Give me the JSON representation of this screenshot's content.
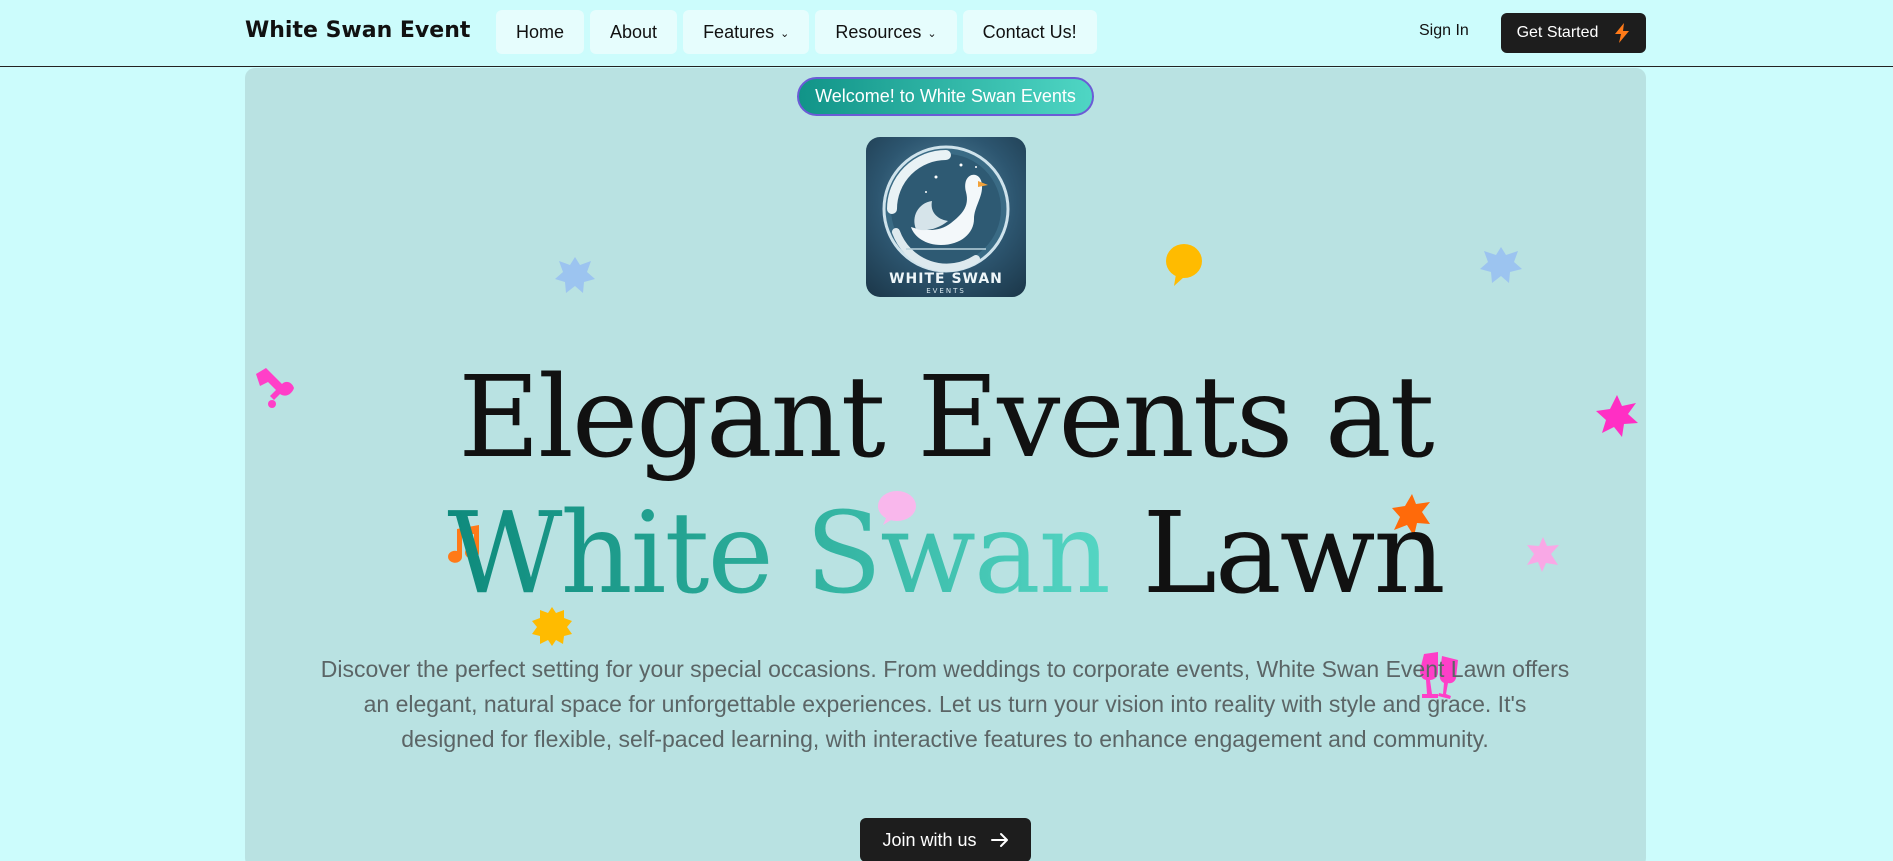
{
  "header": {
    "brand": "White Swan Event",
    "nav": [
      {
        "label": "Home"
      },
      {
        "label": "About"
      },
      {
        "label": "Features",
        "dropdown": true
      },
      {
        "label": "Resources",
        "dropdown": true
      },
      {
        "label": "Contact Us!"
      }
    ],
    "sign_in": "Sign In",
    "get_started": "Get Started"
  },
  "hero": {
    "badge": "Welcome! to White Swan Events",
    "logo": {
      "title": "WHITE SWAN",
      "subtitle": "EVENTS"
    },
    "headline_line1": "Elegant Events at",
    "headline_highlight": "White Swan",
    "headline_end": "Lawn",
    "description": "Discover the perfect setting for your special occasions. From weddings to corporate events, White Swan Event Lawn offers an elegant, natural space for unforgettable experiences. Let us turn your vision into reality with style and grace. It's designed for flexible, self-paced learning, with interactive features to enhance engagement and community.",
    "cta": "Join with us"
  },
  "icons": {
    "chevron": "chevron-down-icon",
    "bolt": "lightning-bolt-icon",
    "arrow": "arrow-right-icon"
  },
  "colors": {
    "page_bg": "#ccfcfc",
    "hero_bg": "#b9e2e2",
    "accent_teal": "#119488",
    "button_dark": "#1d1d1d",
    "bolt_orange": "#ff7a18"
  }
}
